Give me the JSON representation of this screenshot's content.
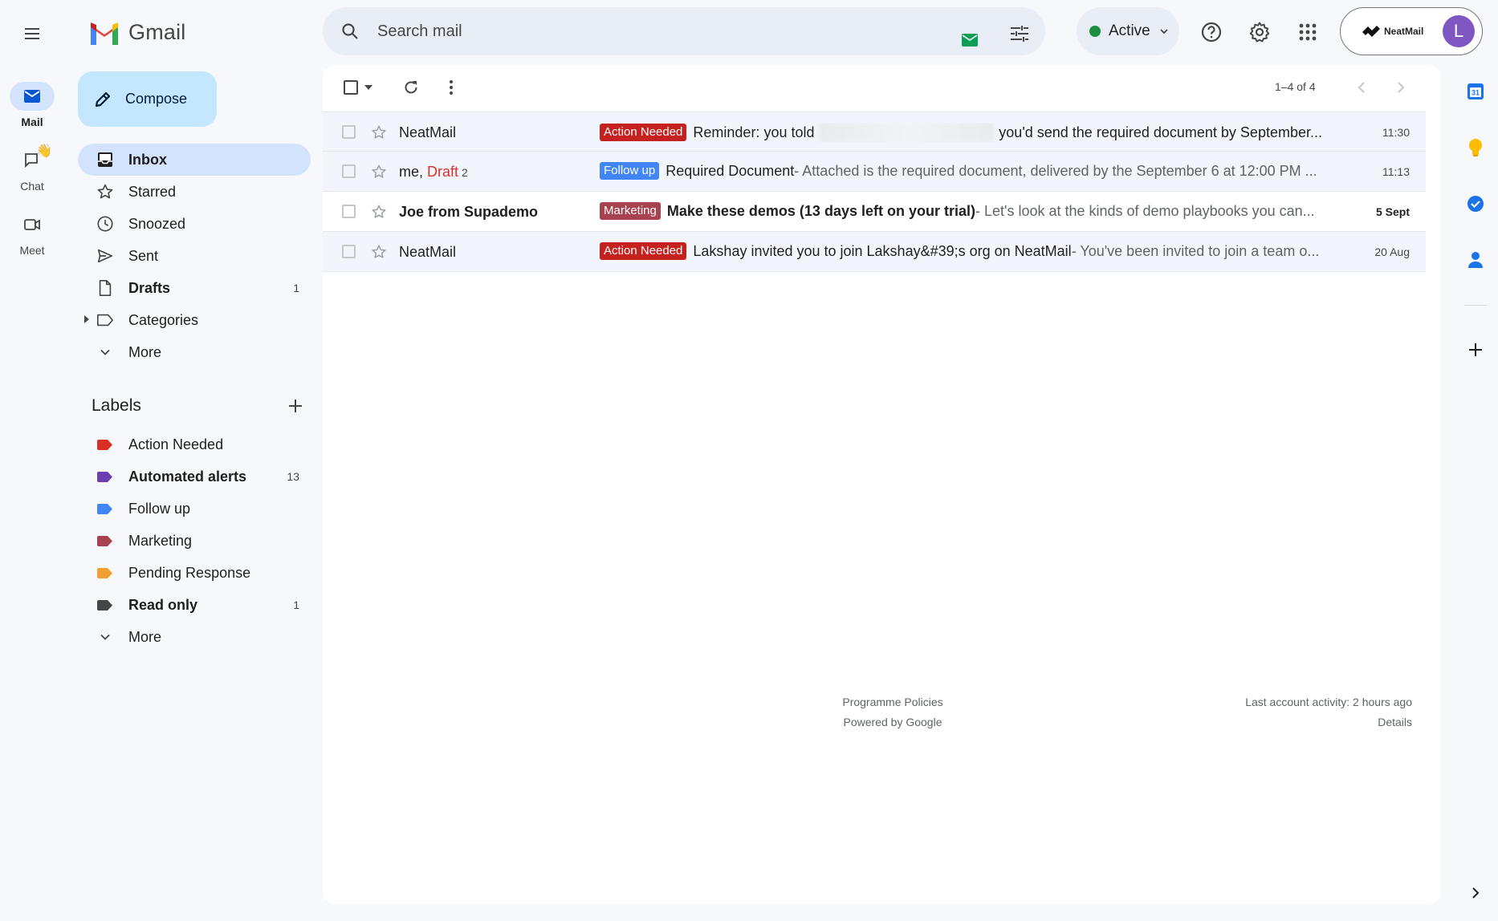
{
  "app": {
    "name": "Gmail"
  },
  "rail": {
    "items": [
      {
        "label": "Mail",
        "icon": "mail-icon",
        "active": true
      },
      {
        "label": "Chat",
        "icon": "chat-icon",
        "active": false
      },
      {
        "label": "Meet",
        "icon": "meet-icon",
        "active": false
      }
    ]
  },
  "search": {
    "placeholder": "Search mail"
  },
  "status": {
    "label": "Active",
    "color": "#1e8e3e"
  },
  "account": {
    "brand": "NeatMail",
    "avatar_letter": "L",
    "avatar_color": "#7e57c2"
  },
  "compose": {
    "label": "Compose"
  },
  "nav": [
    {
      "label": "Inbox",
      "icon": "inbox-icon",
      "count": "",
      "active": true
    },
    {
      "label": "Starred",
      "icon": "star-icon",
      "count": ""
    },
    {
      "label": "Snoozed",
      "icon": "clock-icon",
      "count": ""
    },
    {
      "label": "Sent",
      "icon": "send-icon",
      "count": ""
    },
    {
      "label": "Drafts",
      "icon": "draft-icon",
      "count": "1",
      "bold": true
    },
    {
      "label": "Categories",
      "icon": "label-outline-icon",
      "count": ""
    },
    {
      "label": "More",
      "icon": "chevron-down-icon",
      "count": ""
    }
  ],
  "labels": {
    "title": "Labels",
    "items": [
      {
        "label": "Action Needed",
        "color": "#d93025",
        "count": ""
      },
      {
        "label": "Automated alerts",
        "color": "#6c3fb1",
        "count": "13",
        "bold": true
      },
      {
        "label": "Follow up",
        "color": "#4285f4",
        "count": ""
      },
      {
        "label": "Marketing",
        "color": "#a8424f",
        "count": ""
      },
      {
        "label": "Pending Response",
        "color": "#f0a030",
        "count": ""
      },
      {
        "label": "Read only",
        "color": "#444746",
        "count": "1",
        "bold": true
      }
    ],
    "more": "More"
  },
  "toolbar": {
    "pager": "1–4 of 4"
  },
  "emails": [
    {
      "sender": "NeatMail",
      "unread": false,
      "tag": "Action Needed",
      "tag_color": "#c5221f",
      "subject_pre": "Reminder: you told",
      "subject_post": "you'd send the required document by September...",
      "snippet": "",
      "date": "11:30",
      "blurred": true
    },
    {
      "sender": "me, ",
      "draft": "Draft",
      "thread_count": "2",
      "unread": false,
      "tag": "Follow up",
      "tag_color": "#4285f4",
      "subject": "Required Document",
      "snippet": " - Attached is the required document, delivered by the September 6 at 12:00 PM ...",
      "date": "11:13"
    },
    {
      "sender": "Joe from Supademo",
      "unread": true,
      "tag": "Marketing",
      "tag_color": "#a8424f",
      "subject": "Make these demos (13 days left on your trial)",
      "snippet": " - Let's look at the kinds of demo playbooks you can...",
      "date": "5 Sept"
    },
    {
      "sender": "NeatMail",
      "unread": false,
      "tag": "Action Needed",
      "tag_color": "#c5221f",
      "subject": "Lakshay invited you to join Lakshay&#39;s org on NeatMail",
      "snippet": " - You've been invited to join a team o...",
      "date": "20 Aug"
    }
  ],
  "footer": {
    "policies": "Programme Policies",
    "powered": "Powered by Google",
    "activity": "Last account activity: 2 hours ago",
    "details": "Details"
  },
  "side_panel": {
    "calendar_day": "31",
    "colors": {
      "calendar": "#1a73e8",
      "keep": "#fbbc04",
      "tasks": "#1a73e8",
      "contacts": "#1a73e8"
    }
  }
}
